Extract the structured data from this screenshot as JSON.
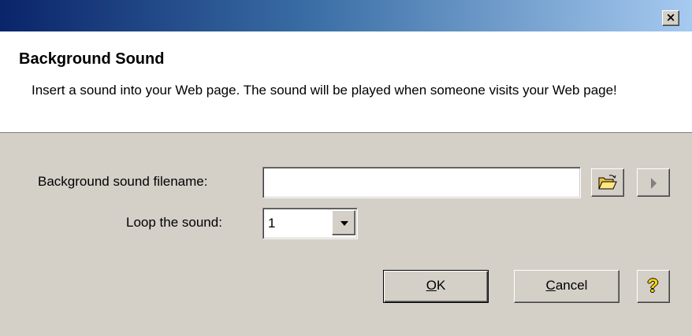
{
  "window": {
    "title": "",
    "close_label": "×"
  },
  "header": {
    "title": "Background Sound",
    "description": "Insert a sound into your Web page.  The sound will be played when someone visits your Web page!"
  },
  "form": {
    "filename_label": "Background sound filename:",
    "filename_value": "",
    "browse_icon": "folder-open-icon",
    "play_icon": "play-icon",
    "loop_label": "Loop the sound:",
    "loop_value": "1"
  },
  "buttons": {
    "ok_mnemonic": "O",
    "ok_rest": "K",
    "cancel_mnemonic": "C",
    "cancel_rest": "ancel",
    "help_icon": "help-icon",
    "help_glyph": "?"
  },
  "colors": {
    "titlebar_start": "#0a246a",
    "titlebar_end": "#a6caf0",
    "face": "#d4d0c8",
    "folder_yellow": "#f0c040"
  }
}
